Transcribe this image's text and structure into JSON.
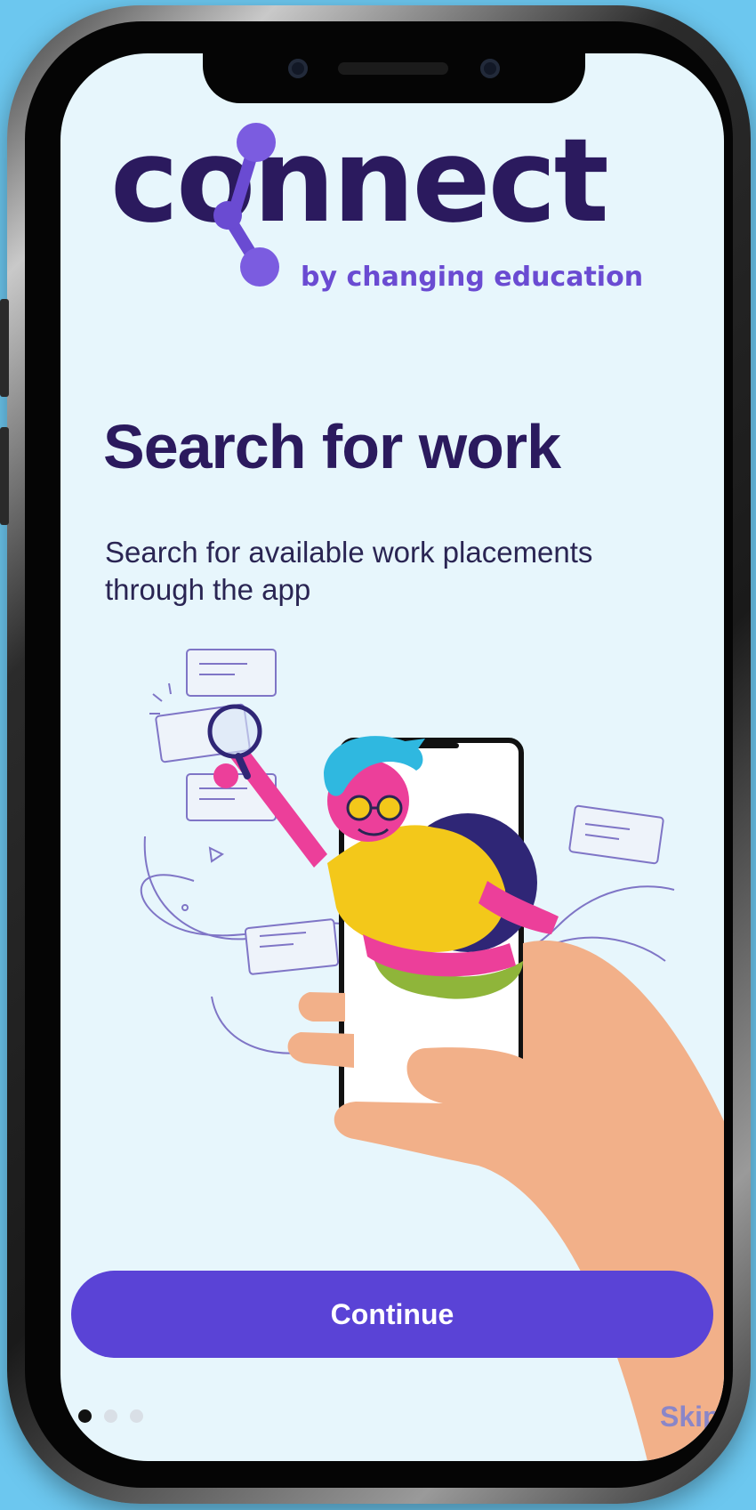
{
  "brand": {
    "wordmark": "connect",
    "tagline": "by changing education",
    "color_dark": "#2b1a5e",
    "color_accent": "#6a4bd2"
  },
  "onboarding": {
    "title": "Search for work",
    "subtitle": "Search for available work placements through the app",
    "illustration": "person-searching-phone-illustration",
    "continue_label": "Continue",
    "skip_label": "Skip",
    "page_indicator": {
      "total": 3,
      "current": 1
    }
  },
  "colors": {
    "page_background": "#6cc7ef",
    "screen_background": "#e7f6fc",
    "button": "#5a43d6",
    "dot_active": "#111111",
    "dot_inactive": "#d9dfe6"
  },
  "icons": [
    "magnifier-icon",
    "phone-notch",
    "front-camera-icon"
  ]
}
